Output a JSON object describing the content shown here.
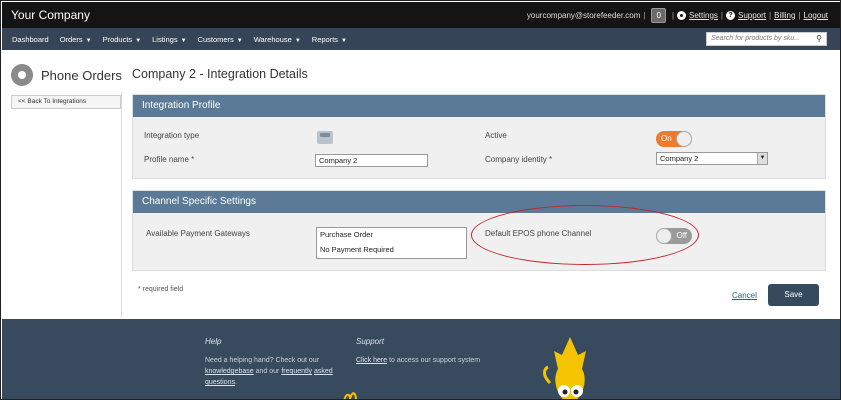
{
  "header": {
    "brand": "Your Company",
    "account_email": "yourcompany@storefeeder.com",
    "cart_count": "0",
    "links": {
      "settings": "Settings",
      "support": "Support",
      "billing": "Billing",
      "logout": "Logout"
    }
  },
  "nav": {
    "items": [
      {
        "label": "Dashboard",
        "dropdown": false
      },
      {
        "label": "Orders",
        "dropdown": true
      },
      {
        "label": "Products",
        "dropdown": true
      },
      {
        "label": "Listings",
        "dropdown": true
      },
      {
        "label": "Customers",
        "dropdown": true
      },
      {
        "label": "Warehouse",
        "dropdown": true
      },
      {
        "label": "Reports",
        "dropdown": true
      }
    ],
    "search_placeholder": "Search for products by sku..."
  },
  "sidebar": {
    "title": "Phone Orders",
    "back_link": "<< Back To Integrations"
  },
  "page": {
    "title": "Company 2 - Integration Details"
  },
  "integration_profile": {
    "heading": "Integration Profile",
    "integration_type_label": "Integration type",
    "active_label": "Active",
    "active_state": "On",
    "profile_name_label": "Profile name *",
    "profile_name_value": "Company 2",
    "company_identity_label": "Company identity *",
    "company_identity_value": "Company 2"
  },
  "channel_settings": {
    "heading": "Channel Specific Settings",
    "payment_gateways_label": "Available Payment Gateways",
    "payment_gateways": [
      "Purchase Order",
      "No Payment Required"
    ],
    "default_channel_label": "Default EPOS phone Channel",
    "default_channel_state": "Off"
  },
  "form": {
    "required_note": "* required field",
    "cancel": "Cancel",
    "save": "Save"
  },
  "footer": {
    "help_title": "Help",
    "help_text_1": "Need a helping hand? Check out our",
    "help_link_kb": "knowledgebase",
    "help_text_2": "and our",
    "help_link_faq_1": "frequently",
    "help_link_faq_2": "asked questions",
    "help_text_3": ".",
    "support_title": "Support",
    "support_link": "Click here",
    "support_text": "to access our support system"
  },
  "colors": {
    "topbar": "#141414",
    "navbar": "#354557",
    "panel_header": "#5a7a97",
    "toggle_on": "#ec7a2f",
    "toggle_off": "#9b9b9b",
    "save_button": "#364a5e",
    "footer": "#384a5d",
    "highlight": "#c0282d"
  }
}
